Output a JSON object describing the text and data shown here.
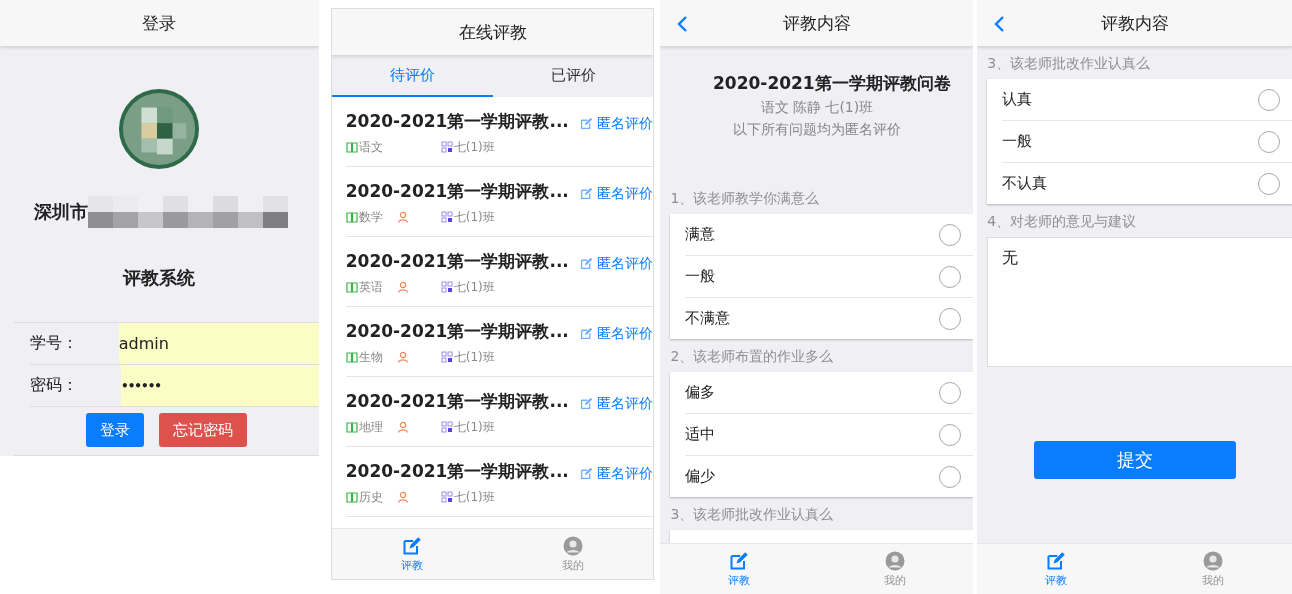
{
  "login": {
    "title": "登录",
    "school_name": "深圳市",
    "system_name": "评教系统",
    "fields": [
      {
        "label": "学号：",
        "value": "admin",
        "kind": "text"
      },
      {
        "label": "密码：",
        "value": "••••••",
        "kind": "password"
      }
    ],
    "buttons": [
      {
        "label": "登录",
        "kind": "primary"
      },
      {
        "label": "忘记密码",
        "kind": "danger"
      }
    ]
  },
  "evaluation_list": {
    "title": "在线评教",
    "tabs": [
      {
        "label": "待评价",
        "selected": true
      },
      {
        "label": "已评价",
        "selected": false
      }
    ],
    "items": [
      {
        "title": "2020-2021第一学期评教...",
        "subject": "语文",
        "teacher_visible": false,
        "class_name": "七(1)班",
        "action": "匿名评价"
      },
      {
        "title": "2020-2021第一学期评教...",
        "subject": "数学",
        "teacher_visible": true,
        "class_name": "七(1)班",
        "action": "匿名评价"
      },
      {
        "title": "2020-2021第一学期评教...",
        "subject": "英语",
        "teacher_visible": true,
        "class_name": "七(1)班",
        "action": "匿名评价"
      },
      {
        "title": "2020-2021第一学期评教...",
        "subject": "生物",
        "teacher_visible": true,
        "class_name": "七(1)班",
        "action": "匿名评价"
      },
      {
        "title": "2020-2021第一学期评教...",
        "subject": "地理",
        "teacher_visible": true,
        "class_name": "七(1)班",
        "action": "匿名评价"
      },
      {
        "title": "2020-2021第一学期评教...",
        "subject": "历史",
        "teacher_visible": true,
        "class_name": "七(1)班",
        "action": "匿名评价"
      }
    ],
    "nav": [
      {
        "label": "评教",
        "selected": true
      },
      {
        "label": "我的",
        "selected": false
      }
    ]
  },
  "survey_pages": [
    {
      "title": "评教内容",
      "intro": {
        "title": "2020-2021第一学期评教问卷",
        "meta": "语文 陈静 七(1)班",
        "note": "以下所有问题均为匿名评价"
      },
      "questions": [
        {
          "kind": "choice",
          "label": "1、该老师教学你满意么",
          "options": [
            {
              "label": "满意",
              "selected": false
            },
            {
              "label": "一般",
              "selected": false
            },
            {
              "label": "不满意",
              "selected": false
            }
          ]
        },
        {
          "kind": "choice",
          "label": "2、该老师布置的作业多么",
          "options": [
            {
              "label": "偏多",
              "selected": false
            },
            {
              "label": "适中",
              "selected": false
            },
            {
              "label": "偏少",
              "selected": false
            }
          ]
        },
        {
          "kind": "choice",
          "label": "3、该老师批改作业认真么"
        }
      ],
      "nav": [
        {
          "label": "评教",
          "selected": true
        },
        {
          "label": "我的",
          "selected": false
        }
      ]
    },
    {
      "title": "评教内容",
      "questions": [
        {
          "kind": "choice",
          "label": "3、该老师批改作业认真么",
          "options": [
            {
              "label": "认真",
              "selected": false
            },
            {
              "label": "一般",
              "selected": false
            },
            {
              "label": "不认真",
              "selected": false
            }
          ]
        },
        {
          "kind": "text",
          "label": "4、对老师的意见与建议",
          "value": "无"
        }
      ],
      "submit": "提交",
      "nav": [
        {
          "label": "评教",
          "selected": true
        },
        {
          "label": "我的",
          "selected": false
        }
      ]
    }
  ]
}
